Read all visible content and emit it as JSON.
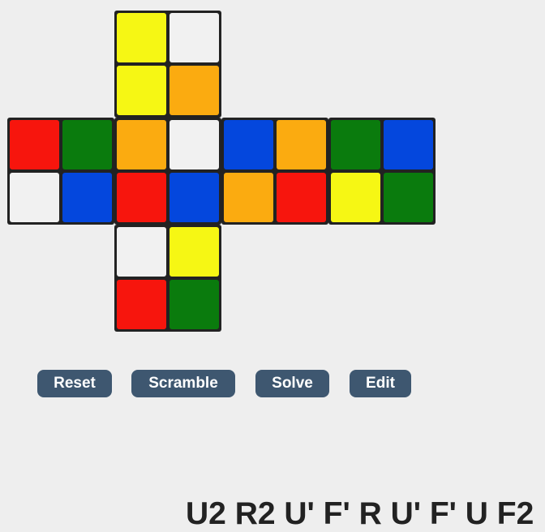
{
  "palette": {
    "yellow": "#f6f714",
    "white": "#f1f1f1",
    "orange": "#fbab10",
    "red": "#f7150d",
    "green": "#0a7b0d",
    "blue": "#0447dd",
    "frame": "#222222",
    "button": "#3e5770"
  },
  "cube": {
    "up": [
      "yellow",
      "white",
      "yellow",
      "orange"
    ],
    "left": [
      "red",
      "green",
      "white",
      "blue"
    ],
    "front": [
      "orange",
      "white",
      "red",
      "blue"
    ],
    "right": [
      "blue",
      "orange",
      "orange",
      "red"
    ],
    "back": [
      "green",
      "blue",
      "yellow",
      "green"
    ],
    "down": [
      "white",
      "yellow",
      "red",
      "green"
    ]
  },
  "buttons": {
    "reset": "Reset",
    "scramble": "Scramble",
    "solve": "Solve",
    "edit": "Edit"
  },
  "solution": "U2 R2 U' F' R U' F' U F2"
}
